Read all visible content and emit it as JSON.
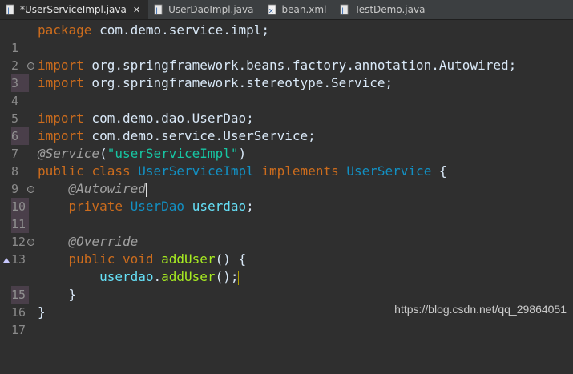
{
  "tabs": [
    {
      "label": "*UserServiceImpl.java",
      "active": true,
      "icon": "java-file-icon",
      "closable": true
    },
    {
      "label": "UserDaoImpl.java",
      "active": false,
      "icon": "java-file-icon"
    },
    {
      "label": "bean.xml",
      "active": false,
      "icon": "xml-file-icon"
    },
    {
      "label": "TestDemo.java",
      "active": false,
      "icon": "java-file-icon"
    }
  ],
  "close_glyph": "✕",
  "lines": [
    {
      "n": "1",
      "t1": "package",
      "t2": " com.demo.service.impl;"
    },
    {
      "n": "2"
    },
    {
      "n": "3",
      "t1": "import",
      "t2": " org.springframework.beans.factory.annotation.Autowired;"
    },
    {
      "n": "4",
      "t1": "import",
      "t2": " org.springframework.stereotype.Service;"
    },
    {
      "n": "5"
    },
    {
      "n": "6",
      "t1": "import",
      "t2": " com.demo.dao.UserDao;"
    },
    {
      "n": "7",
      "t1": "import",
      "t2": " com.demo.service.UserService;"
    },
    {
      "n": "8",
      "ann": "@Service",
      "p1": "(",
      "str": "\"userServiceImpl\"",
      "p2": ")"
    },
    {
      "n": "9",
      "k1": "public",
      "k2": "class",
      "c1": "UserServiceImpl",
      "k3": "implements",
      "c2": "UserService",
      "p": " {"
    },
    {
      "n": "10",
      "ann": "@Autowired"
    },
    {
      "n": "11",
      "k1": "private",
      "c1": "UserDao",
      "f": "userdao",
      "p": ";"
    },
    {
      "n": "12"
    },
    {
      "n": "13",
      "ann": "@Override"
    },
    {
      "n": "14",
      "k1": "public",
      "k2": "void",
      "m": "addUser",
      "p": "() {"
    },
    {
      "n": "15",
      "f": "userdao",
      "p1": ".",
      "m": "addUser",
      "p2": "();"
    },
    {
      "n": "16",
      "p": "}"
    },
    {
      "n": "17",
      "p": "}"
    }
  ],
  "watermark": "https://blog.csdn.net/qq_29864051",
  "colors": {
    "keyword": "#cc6c1d",
    "type": "#1290c3",
    "string": "#17c6a3",
    "field": "#66e1f8",
    "method": "#a7ec21",
    "annotation": "#a0a0a0"
  }
}
